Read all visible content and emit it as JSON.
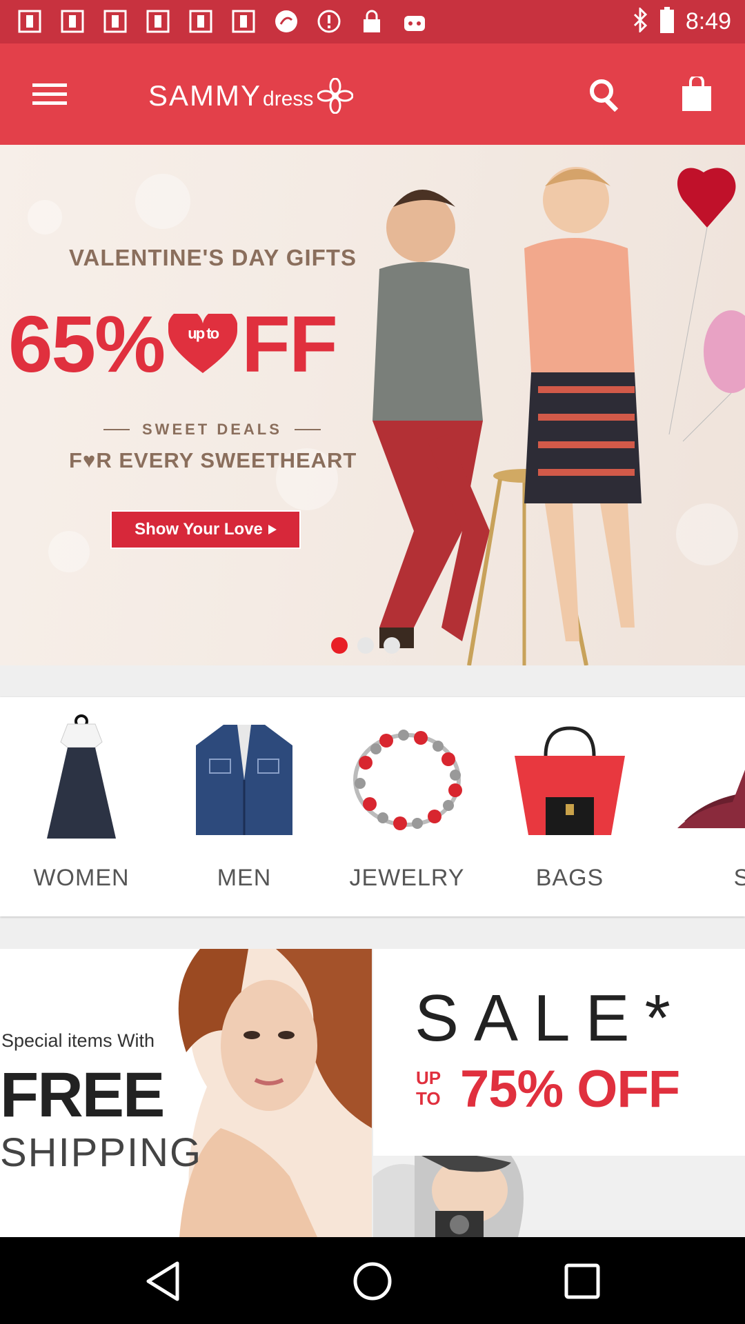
{
  "status_bar": {
    "time": "8:49",
    "icons": [
      "app-icon",
      "app-icon",
      "app-icon",
      "app-icon",
      "app-icon",
      "app-icon",
      "sync-icon",
      "info-icon",
      "lock-icon",
      "robot-icon",
      "bluetooth-icon",
      "battery-icon"
    ]
  },
  "toolbar": {
    "logo_main": "SAMMY",
    "logo_sub": "dress"
  },
  "banner": {
    "headline": "VALENTINE'S DAY GIFTS",
    "discount_left": "65%",
    "heart_text": "up to",
    "discount_right": "FF",
    "sweet_deals": "SWEET DEALS",
    "every": "F♥R EVERY SWEETHEART",
    "cta_label": "Show Your Love",
    "carousel_active": 0,
    "carousel_count": 3
  },
  "categories": [
    {
      "label": "WOMEN"
    },
    {
      "label": "MEN"
    },
    {
      "label": "JEWELRY"
    },
    {
      "label": "BAGS"
    },
    {
      "label": "SHO"
    }
  ],
  "promo": {
    "special": "Special items With",
    "free": "FREE",
    "shipping": "SHIPPING",
    "sale": "SALE*",
    "up": "UP",
    "to": "TO",
    "pct": "75% OFF"
  },
  "colors": {
    "brand_red": "#e3404a",
    "status_red": "#c8323f",
    "accent": "#e0303e"
  }
}
